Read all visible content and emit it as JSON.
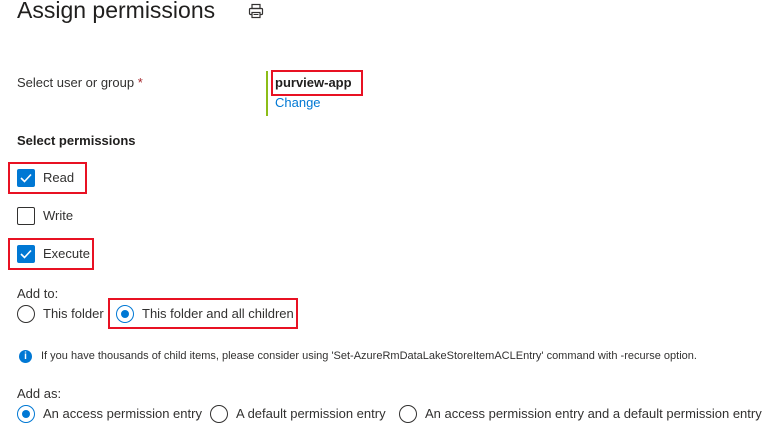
{
  "header": {
    "title": "Assign permissions",
    "print_icon": "print-icon"
  },
  "user_field": {
    "label": "Select user or group",
    "required_marker": "*",
    "selected_user": "purview-app",
    "change_link": "Change"
  },
  "permissions": {
    "heading": "Select permissions",
    "options": [
      {
        "label": "Read",
        "checked": true
      },
      {
        "label": "Write",
        "checked": false
      },
      {
        "label": "Execute",
        "checked": true
      }
    ]
  },
  "add_to": {
    "label": "Add to:",
    "options": [
      {
        "label": "This folder",
        "selected": false
      },
      {
        "label": "This folder and all children",
        "selected": true
      }
    ]
  },
  "info": {
    "icon": "info-icon",
    "text": "If you have thousands of child items, please consider using 'Set-AzureRmDataLakeStoreItemACLEntry' command with -recurse option."
  },
  "add_as": {
    "label": "Add as:",
    "options": [
      {
        "label": "An access permission entry",
        "selected": true
      },
      {
        "label": "A default permission entry",
        "selected": false
      },
      {
        "label": "An access permission entry and a default permission entry",
        "selected": false
      }
    ]
  },
  "colors": {
    "accent": "#0078d4",
    "highlight": "#e81123",
    "user_bar": "#8cbd18",
    "required": "#a4262c"
  }
}
